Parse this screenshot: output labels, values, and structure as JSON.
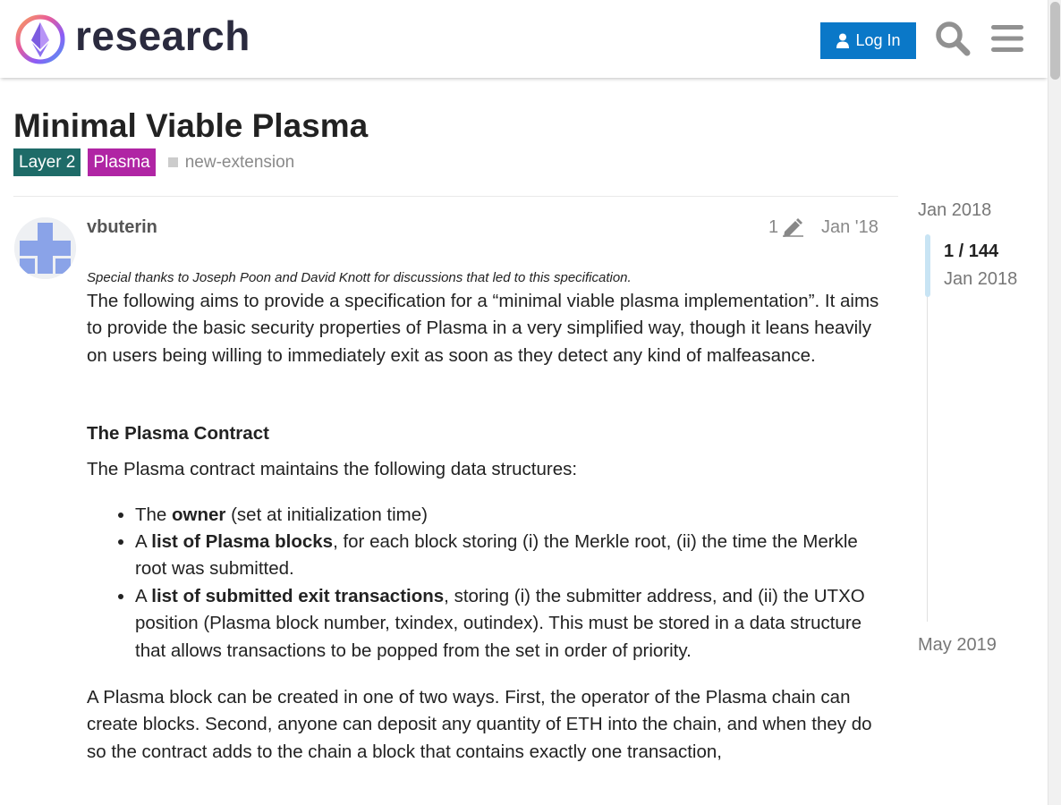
{
  "header": {
    "site_name": "research",
    "login_label": "Log In",
    "accent_color": "#0a78c8"
  },
  "topic": {
    "title": "Minimal Viable Plasma",
    "categories": [
      {
        "label": "Layer 2",
        "color": "#1e6b68"
      },
      {
        "label": "Plasma",
        "color": "#b025a4"
      }
    ],
    "tags": [
      "new-extension"
    ]
  },
  "post": {
    "username": "vbuterin",
    "edit_count": "1",
    "date": "Jan '18",
    "thanks": "Special thanks to Joseph Poon and David Knott for discussions that led to this specification.",
    "intro": "The following aims to provide a specification for a “minimal viable plasma implementation”. It aims to provide the basic security properties of Plasma in a very simplified way, though it leans heavily on users being willing to immediately exit as soon as they detect any kind of malfeasance.",
    "section_heading": "The Plasma Contract",
    "section_lead": "The Plasma contract maintains the following data structures:",
    "list": [
      {
        "pre": "The ",
        "bold": "owner",
        "post": " (set at initialization time)"
      },
      {
        "pre": "A ",
        "bold": "list of Plasma blocks",
        "post": ", for each block storing (i) the Merkle root, (ii) the time the Merkle root was submitted."
      },
      {
        "pre": "A ",
        "bold": "list of submitted exit transactions",
        "post": ", storing (i) the submitter address, and (ii) the UTXO position (Plasma block number, txindex, outindex). This must be stored in a data structure that allows transactions to be popped from the set in order of priority."
      }
    ],
    "closing": "A Plasma block can be created in one of two ways. First, the operator of the Plasma chain can create blocks. Second, anyone can deposit any quantity of ETH into the chain, and when they do so the contract adds to the chain a block that contains exactly one transaction,"
  },
  "timeline": {
    "start_label": "Jan 2018",
    "position": "1 / 144",
    "current_label": "Jan 2018",
    "end_label": "May 2019"
  },
  "icons": [
    "logo-icon",
    "user-icon",
    "search-icon",
    "menu-icon",
    "pencil-icon",
    "avatar"
  ]
}
